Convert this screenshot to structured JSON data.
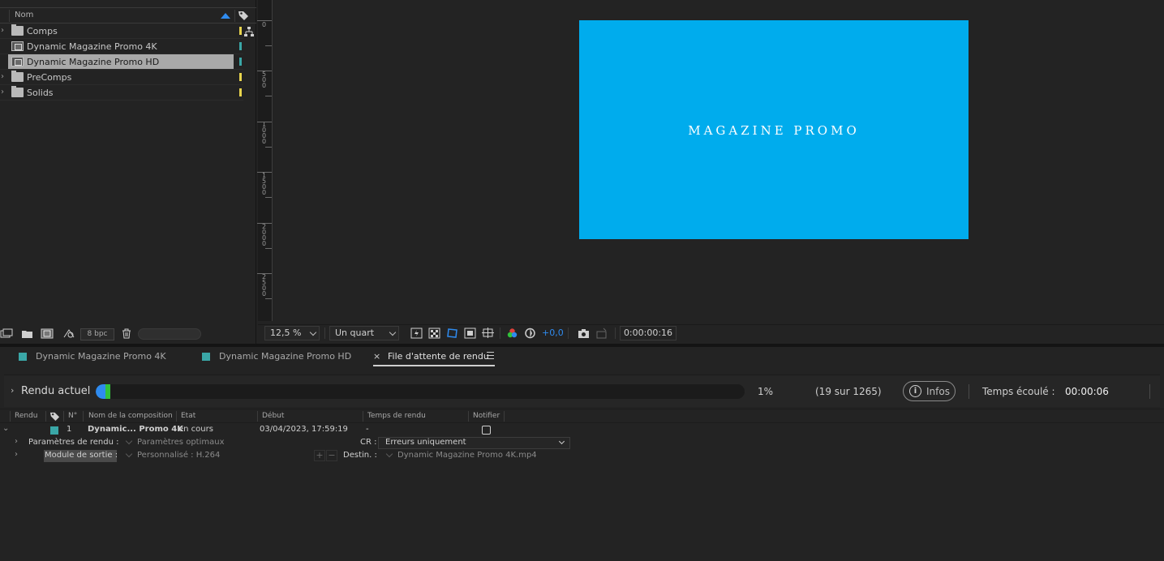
{
  "project": {
    "column_name": "Nom",
    "items": [
      {
        "label": "Comps",
        "type": "folder",
        "color": "#e8d44d"
      },
      {
        "label": "Dynamic Magazine Promo 4K",
        "type": "comp",
        "color": "#3aa7a7"
      },
      {
        "label": "Dynamic Magazine Promo HD",
        "type": "comp",
        "color": "#3aa7a7",
        "selected": true
      },
      {
        "label": "PreComps",
        "type": "folder",
        "color": "#e8d44d"
      },
      {
        "label": "Solids",
        "type": "folder",
        "color": "#e8d44d"
      }
    ],
    "bpc_label": "8 bpc"
  },
  "viewer": {
    "comp_text": "MAGAZINE PROMO",
    "comp_color": "#00aced",
    "ruler_labels": [
      "0",
      "500",
      "1000",
      "1500",
      "2000",
      "2500"
    ],
    "zoom": "12,5 %",
    "resolution": "Un quart",
    "exposure": "+0,0",
    "timecode": "0:00:00:16"
  },
  "tabs": [
    {
      "label": "Dynamic Magazine Promo 4K",
      "color": "#3aa7a7"
    },
    {
      "label": "Dynamic Magazine Promo HD",
      "color": "#3aa7a7"
    }
  ],
  "render_tab": {
    "close": "×",
    "label": "File d'attente de rendu"
  },
  "current_render": {
    "title": "Rendu actuel",
    "progress_percent": 1,
    "percent_label": "1%",
    "frames_label": "(19 sur 1265)",
    "infos_label": "Infos",
    "elapsed_label": "Temps écoulé :",
    "elapsed_value": "00:00:06"
  },
  "queue": {
    "columns": [
      "Rendu",
      "N°",
      "Nom de la composition",
      "Etat",
      "Début",
      "Temps de rendu",
      "Notifier"
    ],
    "item": {
      "number": "1",
      "comp_name": "Dynamic... Promo 4K",
      "status": "en cours",
      "start": "03/04/2023, 17:59:19",
      "render_time": "-",
      "color": "#3aa7a7"
    },
    "render_settings_label": "Paramètres de rendu :",
    "render_settings_value": "Paramètres optimaux",
    "log_label": "CR :",
    "log_value": "Erreurs uniquement",
    "output_module_label": "Module de sortie :",
    "output_module_value": "Personnalisé : H.264",
    "plus": "+",
    "minus": "−",
    "dest_label": "Destin. :",
    "dest_value": "Dynamic Magazine Promo 4K.mp4"
  }
}
